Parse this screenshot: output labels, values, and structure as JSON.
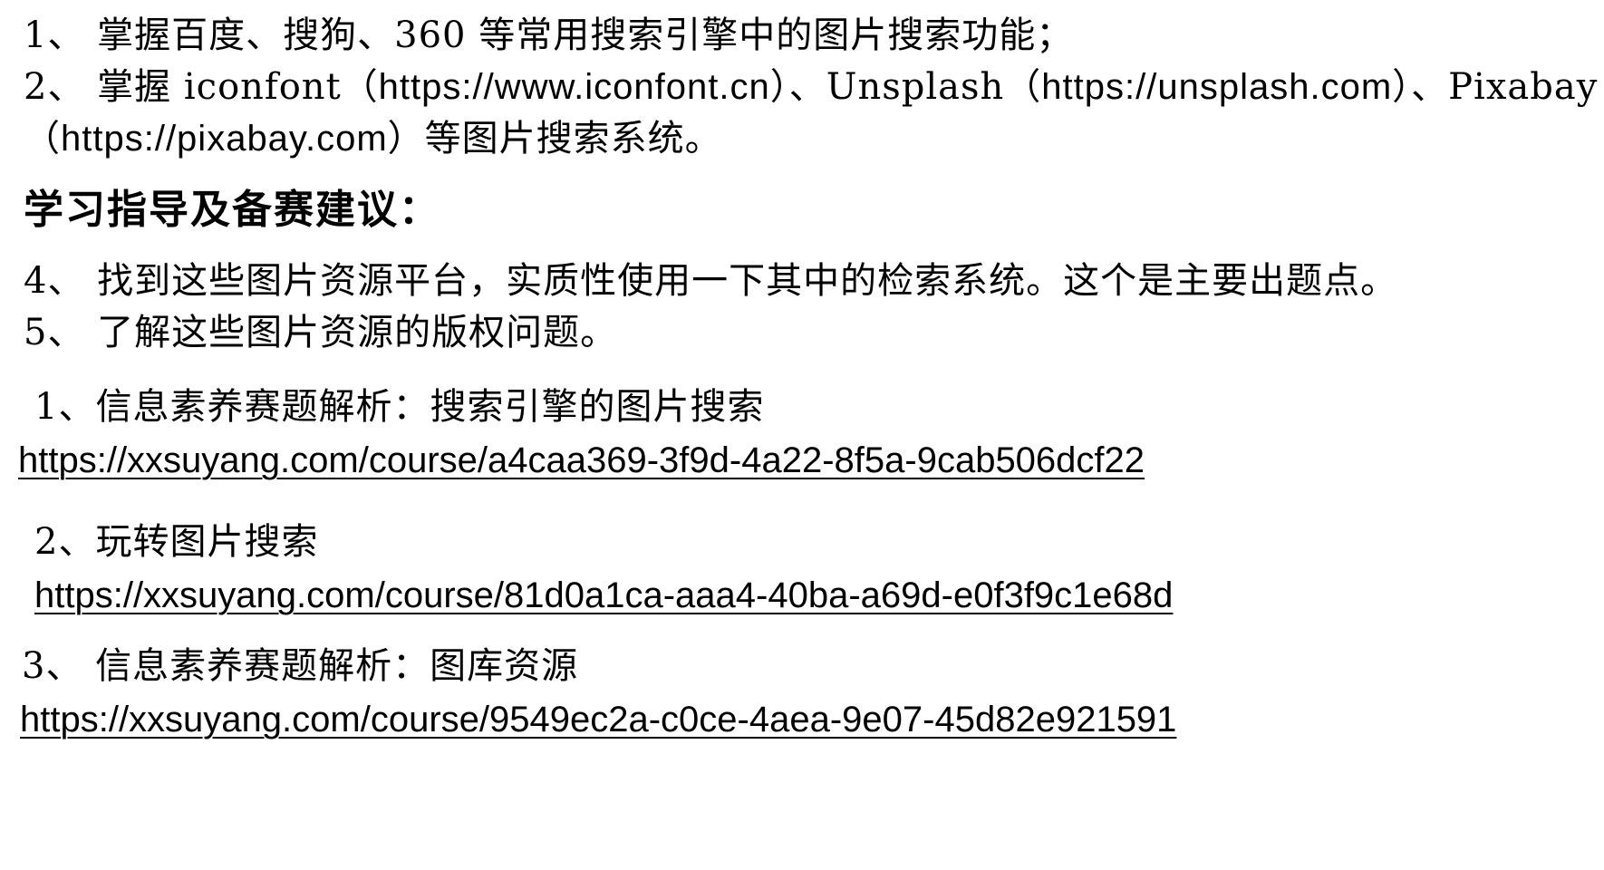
{
  "objectives": {
    "item1": "1、 掌握百度、搜狗、360 等常用搜索引擎中的图片搜索功能；",
    "item2_prefix": "2、 掌握 iconfont（",
    "item2_url1": "https://www.iconfont.cn",
    "item2_mid1": "）、Unsplash（",
    "item2_url2": "https://unsplash.com",
    "item2_mid2": "）、Pixabay",
    "item2_line2_open": "（",
    "item2_url3": "https://pixabay.com",
    "item2_line2_close": "）等图片搜索系统。"
  },
  "guidance": {
    "heading": "学习指导及备赛建议：",
    "item4": "4、 找到这些图片资源平台，实质性使用一下其中的检索系统。这个是主要出题点。",
    "item5": "5、 了解这些图片资源的版权问题。"
  },
  "courses": [
    {
      "title": "1、信息素养赛题解析：搜索引擎的图片搜索",
      "url": "https://xxsuyang.com/course/a4caa369-3f9d-4a22-8f5a-9cab506dcf22"
    },
    {
      "title": "2、玩转图片搜索",
      "url": "https://xxsuyang.com/course/81d0a1ca-aaa4-40ba-a69d-e0f3f9c1e68d"
    },
    {
      "title": "3、 信息素养赛题解析：图库资源",
      "url": "https://xxsuyang.com/course/9549ec2a-c0ce-4aea-9e07-45d82e921591"
    }
  ]
}
